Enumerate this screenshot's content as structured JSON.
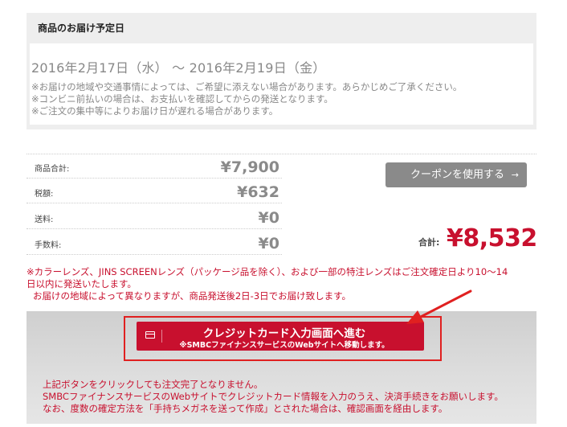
{
  "delivery": {
    "title": "商品のお届け予定日",
    "dates": "2016年2月17日（水） ～ 2016年2月19日（金）",
    "notes": [
      "※お届けの地域や交通事情によっては、ご希望に添えない場合があります。あらかじめご了承ください。",
      "※コンビニ前払いの場合は、お支払いを確認してからの発送となります。",
      "※ご注文の集中等によりお届け日が遅れる場合があります。"
    ]
  },
  "prices": {
    "rows": [
      {
        "label": "商品合計:",
        "value": "¥7,900"
      },
      {
        "label": "税額:",
        "value": "¥632"
      },
      {
        "label": "送料:",
        "value": "¥0"
      },
      {
        "label": "手数料:",
        "value": "¥0"
      }
    ],
    "coupon_label": "クーポンを使用する",
    "coupon_arrow": "→",
    "total_label": "合計:",
    "total_value": "¥8,532"
  },
  "notice": {
    "line1": "※カラーレンズ、JINS SCREENレンズ（パッケージ品を除く）、および一部の特注レンズはご注文確定日より10～14",
    "line2": "日以内に発送いたします。",
    "line3": "お届けの地域によって異なりますが、商品発送後2日-3日でお届け致します。"
  },
  "checkout": {
    "button_main": "クレジットカード入力画面へ進む",
    "button_sub": "※SMBCファイナンスサービスのWebサイトへ移動します。",
    "notes": [
      "上記ボタンをクリックしても注文完了となりません。",
      "SMBCファイナンスサービスのWebサイトでクレジットカード情報を入力のうえ、決済手続きをお願いします。",
      "なお、度数の確定方法を「手持ちメガネを送って作成」とされた場合は、確認画面を経由します。"
    ]
  },
  "colors": {
    "accent_red": "#c8102e",
    "annotation_red": "#e02020",
    "gray_button": "#8a8a8a"
  }
}
